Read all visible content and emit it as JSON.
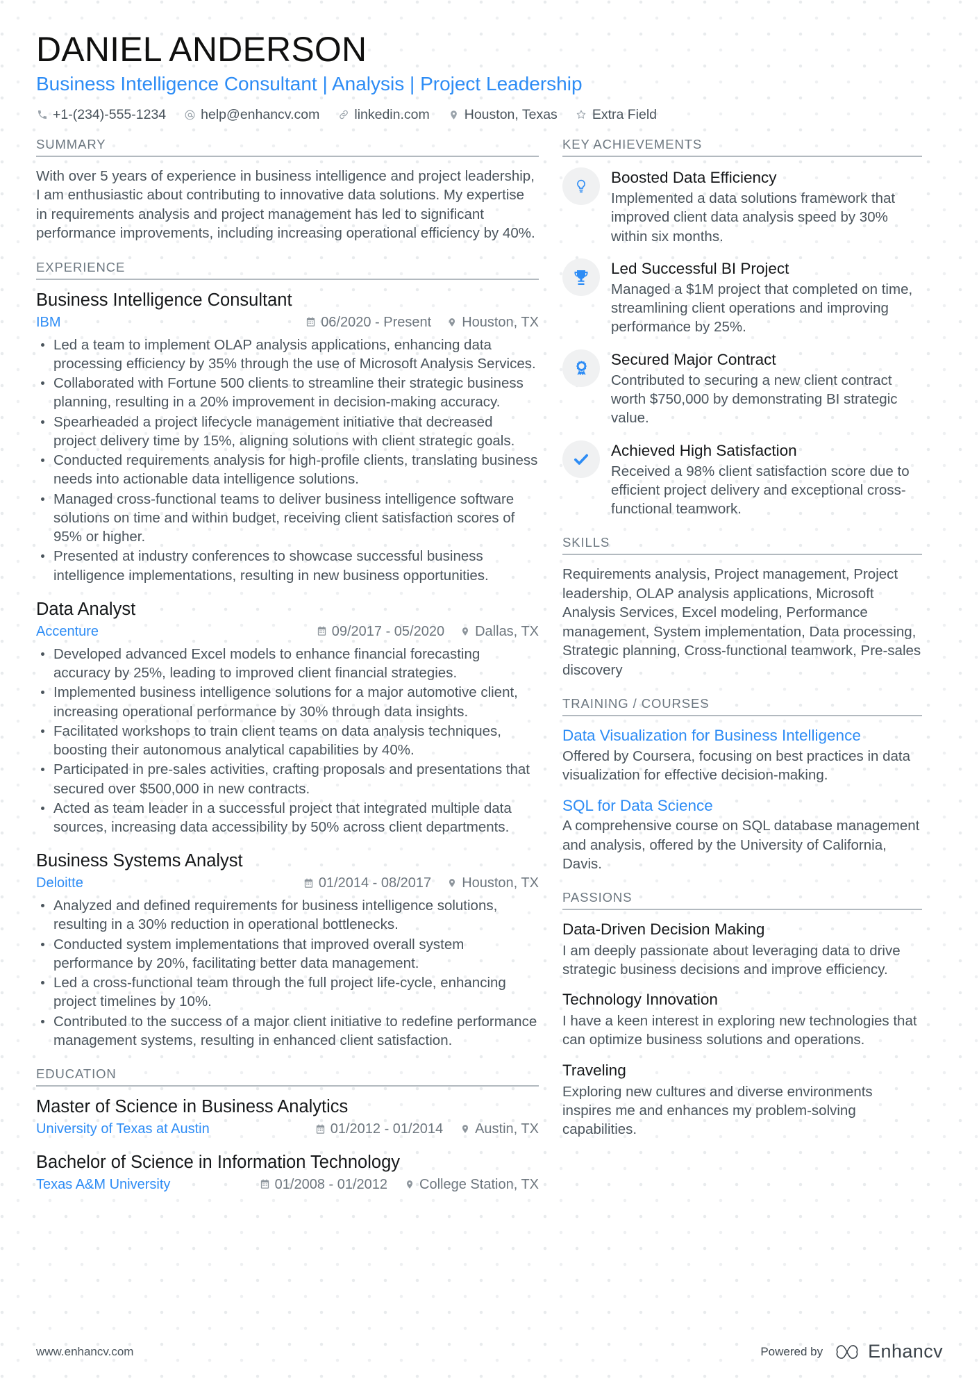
{
  "header": {
    "name": "DANIEL ANDERSON",
    "headline": "Business Intelligence Consultant | Analysis | Project Leadership",
    "contacts": [
      {
        "icon": "phone-icon",
        "text": "+1-(234)-555-1234"
      },
      {
        "icon": "email-icon",
        "text": "help@enhancv.com"
      },
      {
        "icon": "link-icon",
        "text": "linkedin.com"
      },
      {
        "icon": "location-pin-icon",
        "text": "Houston, Texas"
      },
      {
        "icon": "star-icon",
        "text": "Extra Field"
      }
    ]
  },
  "summary": {
    "heading": "SUMMARY",
    "text": "With over 5 years of experience in business intelligence and project leadership, I am enthusiastic about contributing to innovative data solutions. My expertise in requirements analysis and project management has led to significant performance improvements, including increasing operational efficiency by 40%."
  },
  "experience": {
    "heading": "EXPERIENCE",
    "entries": [
      {
        "title": "Business Intelligence Consultant",
        "organization": "IBM",
        "dates": "06/2020 - Present",
        "location": "Houston, TX",
        "bullets": [
          "Led a team to implement OLAP analysis applications, enhancing data processing efficiency by 35% through the use of Microsoft Analysis Services.",
          "Collaborated with Fortune 500 clients to streamline their strategic business planning, resulting in a 20% improvement in decision-making accuracy.",
          "Spearheaded a project lifecycle management initiative that decreased project delivery time by 15%, aligning solutions with client strategic goals.",
          "Conducted requirements analysis for high-profile clients, translating business needs into actionable data intelligence solutions.",
          "Managed cross-functional teams to deliver business intelligence software solutions on time and within budget, receiving client satisfaction scores of 95% or higher.",
          "Presented at industry conferences to showcase successful business intelligence implementations, resulting in new business opportunities."
        ]
      },
      {
        "title": "Data Analyst",
        "organization": "Accenture",
        "dates": "09/2017 - 05/2020",
        "location": "Dallas, TX",
        "bullets": [
          "Developed advanced Excel models to enhance financial forecasting accuracy by 25%, leading to improved client financial strategies.",
          "Implemented business intelligence solutions for a major automotive client, increasing operational performance by 30% through data insights.",
          "Facilitated workshops to train client teams on data analysis techniques, boosting their autonomous analytical capabilities by 40%.",
          "Participated in pre-sales activities, crafting proposals and presentations that secured over $500,000 in new contracts.",
          "Acted as team leader in a successful project that integrated multiple data sources, increasing data accessibility by 50% across client departments."
        ]
      },
      {
        "title": "Business Systems Analyst",
        "organization": "Deloitte",
        "dates": "01/2014 - 08/2017",
        "location": "Houston, TX",
        "bullets": [
          "Analyzed and defined requirements for business intelligence solutions, resulting in a 30% reduction in operational bottlenecks.",
          "Conducted system implementations that improved overall system performance by 20%, facilitating better data management.",
          "Led a cross-functional team through the full project life-cycle, enhancing project timelines by 10%.",
          "Contributed to the success of a major client initiative to redefine performance management systems, resulting in enhanced client satisfaction."
        ]
      }
    ]
  },
  "education": {
    "heading": "EDUCATION",
    "entries": [
      {
        "title": "Master of Science in Business Analytics",
        "organization": "University of Texas at Austin",
        "dates": "01/2012 - 01/2014",
        "location": "Austin, TX"
      },
      {
        "title": "Bachelor of Science in Information Technology",
        "organization": "Texas A&M University",
        "dates": "01/2008 - 01/2012",
        "location": "College Station, TX"
      }
    ]
  },
  "key_achievements": {
    "heading": "KEY ACHIEVEMENTS",
    "items": [
      {
        "icon": "lightbulb-icon",
        "title": "Boosted Data Efficiency",
        "text": "Implemented a data solutions framework that improved client data analysis speed by 30% within six months."
      },
      {
        "icon": "trophy-icon",
        "title": "Led Successful BI Project",
        "text": "Managed a $1M project that completed on time, streamlining client operations and improving performance by 25%."
      },
      {
        "icon": "award-ribbon-icon",
        "title": "Secured Major Contract",
        "text": "Contributed to securing a new client contract worth $750,000 by demonstrating BI strategic value."
      },
      {
        "icon": "checkmark-icon",
        "title": "Achieved High Satisfaction",
        "text": "Received a 98% client satisfaction score due to efficient project delivery and exceptional cross-functional teamwork."
      }
    ]
  },
  "skills": {
    "heading": "SKILLS",
    "text": "Requirements analysis, Project management, Project leadership, OLAP analysis applications, Microsoft Analysis Services, Excel modeling, Performance management, System implementation, Data processing, Strategic planning, Cross-functional teamwork, Pre-sales discovery"
  },
  "training": {
    "heading": "TRAINING / COURSES",
    "items": [
      {
        "title": "Data Visualization for Business Intelligence",
        "text": "Offered by Coursera, focusing on best practices in data visualization for effective decision-making."
      },
      {
        "title": "SQL for Data Science",
        "text": "A comprehensive course on SQL database management and analysis, offered by the University of California, Davis."
      }
    ]
  },
  "passions": {
    "heading": "PASSIONS",
    "items": [
      {
        "title": "Data-Driven Decision Making",
        "text": "I am deeply passionate about leveraging data to drive strategic business decisions and improve efficiency."
      },
      {
        "title": "Technology Innovation",
        "text": "I have a keen interest in exploring new technologies that can optimize business solutions and operations."
      },
      {
        "title": "Traveling",
        "text": "Exploring new cultures and diverse environments inspires me and enhances my problem-solving capabilities."
      }
    ]
  },
  "footer": {
    "url": "www.enhancv.com",
    "powered_by": "Powered by",
    "brand": "Enhancv"
  },
  "colors": {
    "accent": "#2d8cf5",
    "heading": "#6c7780",
    "body": "#4a545c",
    "title": "#16181a",
    "icon_circle": "#f0f1f2"
  }
}
